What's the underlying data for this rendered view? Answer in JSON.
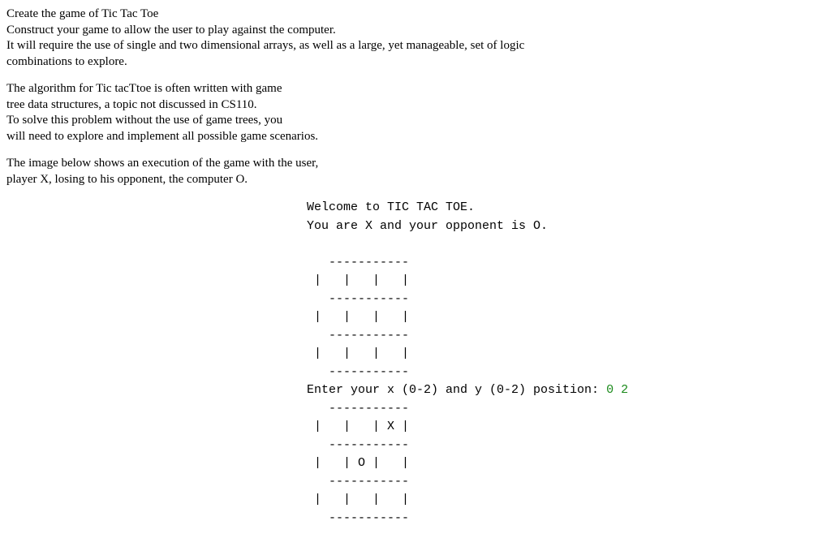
{
  "instructions": {
    "p1": {
      "l1": "Create the game of Tic Tac Toe",
      "l2": "Construct your game to allow the user to play against the computer.",
      "l3": "It will require the use of single and two dimensional arrays, as well as a large, yet manageable, set of logic",
      "l4": "combinations to explore."
    },
    "p2": {
      "l1": "The algorithm for Tic tacTtoe is often written with game",
      "l2": "tree data structures, a topic not discussed in CS110.",
      "l3": "To solve this problem without the use of game trees, you",
      "l4": "will need to explore and implement all possible game scenarios."
    },
    "p3": {
      "l1": "The image below shows an execution of the game with the user,",
      "l2": "player X, losing to his opponent, the computer O."
    }
  },
  "console": {
    "welcome1": "Welcome to TIC TAC TOE.",
    "welcome2": "You are X and your opponent is O.",
    "blank": "",
    "divider": "   -----------",
    "emptyRow": " |   |   |   |",
    "prompt": "Enter your x (0-2) and y (0-2) position: ",
    "userInput": "0 2",
    "row0b": " |   |   | X |",
    "row1b": " |   | O |   |",
    "row2b": " |   |   |   |"
  }
}
